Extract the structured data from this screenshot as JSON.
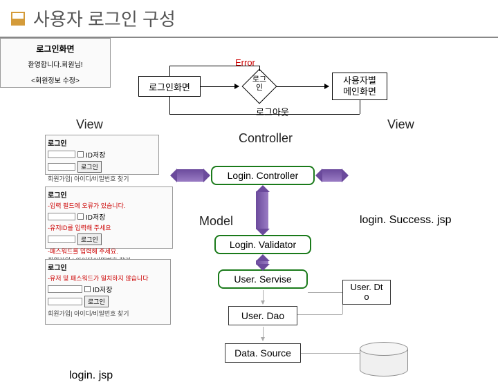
{
  "title": "사용자 로그인 구성",
  "flow": {
    "login_screen": "로그인화면",
    "diamond_label": "로그\n인",
    "user_main": "사용자별\n메인화면",
    "error": "Error",
    "logout": "로그아웃"
  },
  "sections": {
    "view": "View",
    "controller": "Controller",
    "model": "Model"
  },
  "stack": {
    "login_controller": "Login. Controller",
    "login_validator": "Login. Validator",
    "user_service": "User. Servise",
    "user_dao": "User. Dao",
    "data_source": "Data. Source",
    "user_dto": "User. Dt\no"
  },
  "files": {
    "login_jsp": "login. jsp",
    "login_success_jsp": "login. Success. jsp"
  },
  "mock_login": {
    "header": "로그인",
    "id_save": "ID저장",
    "login_btn": "로그인",
    "footer": "회원가입| 아이디/비밀번호 찾기"
  },
  "mock_login2": {
    "header": "로그인",
    "err1": "-입력 필드에 오류가 있습니다.",
    "id_save": "ID저장",
    "err2": "-유저ID를 입력해 주세요",
    "login_btn": "로그인",
    "err3": "-패스워드를 입력해 주세요.",
    "footer": "회원가입 | 아이디/비밀번호 찾기"
  },
  "mock_login3": {
    "header": "로그인",
    "err1": "-유저 및 패스워드가 일치하지 않습니다",
    "id_save": "ID저장",
    "login_btn": "로그인",
    "footer": "회원가입| 아이디/비밀번호 찾기"
  },
  "mock_success": {
    "header": "로그인화면",
    "welcome": "환영합니다.회원님!",
    "edit": "<회원정보 수정>"
  }
}
